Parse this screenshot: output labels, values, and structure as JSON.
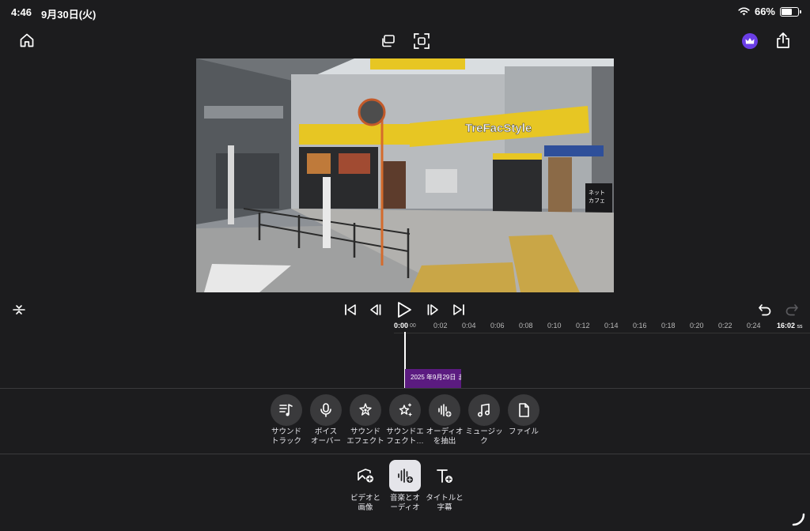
{
  "status": {
    "time": "4:46",
    "date": "9月30日(火)",
    "battery": "66%",
    "battery_level": 0.66
  },
  "playback": {
    "ruler_ticks": [
      "0:00",
      "00",
      "0:02",
      "0:04",
      "0:06",
      "0:08",
      "0:10",
      "0:12",
      "0:14",
      "0:16",
      "0:18",
      "0:20",
      "0:22",
      "0:24"
    ],
    "ruler_end": "16:02",
    "ruler_end_unit": "ss"
  },
  "timeline": {
    "clip_label": "2025 年9月29日 ま"
  },
  "audio_tools": [
    {
      "name": "soundtrack",
      "label": "サウンド\nトラック",
      "icon": "music-list-icon"
    },
    {
      "name": "voiceover",
      "label": "ボイス\nオーバー",
      "icon": "microphone-icon"
    },
    {
      "name": "sound-effect",
      "label": "サウンド\nエフェクト",
      "icon": "sparkle-icon"
    },
    {
      "name": "sound-effect-2",
      "label": "サウンドエ\nフェクト…",
      "icon": "sparkle-multi-icon"
    },
    {
      "name": "extract-audio",
      "label": "オーディオ\nを抽出",
      "icon": "waveform-add-icon"
    },
    {
      "name": "music",
      "label": "ミュージッ\nク",
      "icon": "music-note-icon"
    },
    {
      "name": "file",
      "label": "ファイル",
      "icon": "file-icon"
    }
  ],
  "bottom_tabs": [
    {
      "name": "video-image",
      "label": "ビデオと\n画像",
      "icon": "image-add-icon",
      "active": false
    },
    {
      "name": "music-audio",
      "label": "音楽とオ\nーディオ",
      "icon": "waveform-add-icon",
      "active": true
    },
    {
      "name": "title-caption",
      "label": "タイトルと\n字幕",
      "icon": "text-add-icon",
      "active": false
    }
  ],
  "colors": {
    "background": "#1c1c1e",
    "clip": "#5b1b80",
    "premium": "#6a3ee6"
  }
}
